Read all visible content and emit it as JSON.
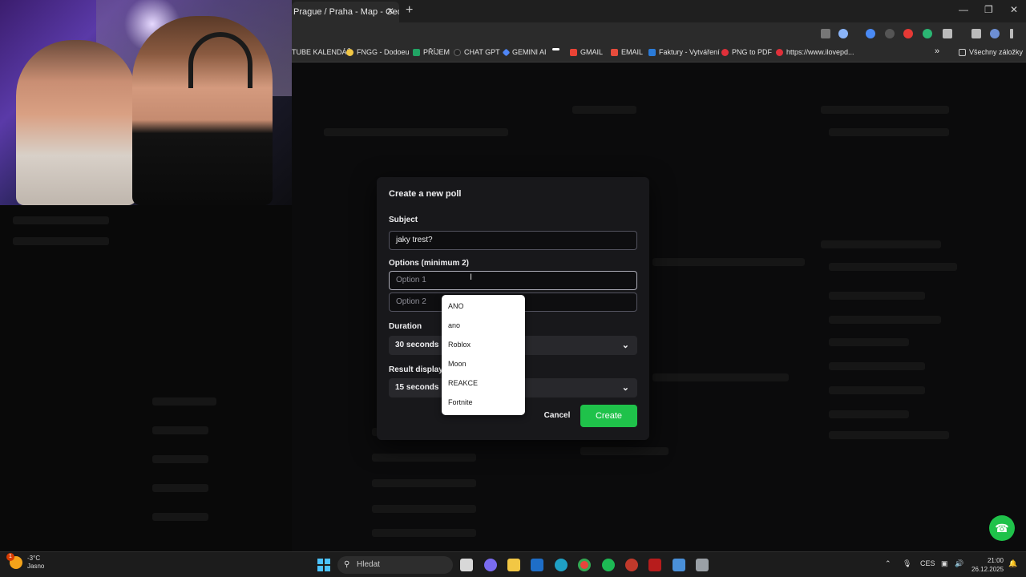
{
  "browser": {
    "tab_title": "Prague / Praha - Map - GeoGu",
    "tab_close": "✕",
    "new_tab": "+",
    "window_controls": [
      "—",
      "❐",
      "✕"
    ]
  },
  "bookmarks": [
    {
      "label": "TUBE KALENDÁŘ",
      "color": "#444444"
    },
    {
      "label": "FNGG - Dodoeu",
      "color": "#f2c744"
    },
    {
      "label": "PŘÍJEM",
      "color": "#21a464"
    },
    {
      "label": "CHAT GPT",
      "color": "#222222"
    },
    {
      "label": "GEMINI AI",
      "color": "#4f86f7"
    },
    {
      "label": "",
      "color": "#ffffff"
    },
    {
      "label": "GMAIL",
      "color": "#ea4335"
    },
    {
      "label": "EMAIL",
      "color": "#e74c3c"
    },
    {
      "label": "Faktury - Vytváření",
      "color": "#2b7bd8"
    },
    {
      "label": "PNG to PDF",
      "color": "#e0303a"
    },
    {
      "label": "https://www.ilovepd...",
      "color": "#e0303a"
    }
  ],
  "bookmarks_more": "»",
  "bookmarks_all": "Všechny záložky",
  "modal": {
    "title": "Create a new poll",
    "subject_label": "Subject",
    "subject_value": "jaky trest?",
    "options_label": "Options (minimum 2)",
    "option1_placeholder": "Option 1",
    "option2_placeholder": "Option 2",
    "duration_label": "Duration",
    "duration_value": "30 seconds",
    "result_label": "Result displayed",
    "result_value": "15 seconds",
    "cancel": "Cancel",
    "create": "Create"
  },
  "autocomplete": [
    "ANO",
    "ano",
    "Roblox",
    "Moon",
    "REAKCE",
    "Fortnite"
  ],
  "taskbar": {
    "weather_temp": "-3°C",
    "weather_desc": "Jasno",
    "weather_badge": "1",
    "search_placeholder": "Hledat",
    "lang": "CES",
    "time": "21:00",
    "date": "26.12.2025"
  },
  "colors": {
    "accent_green": "#1fc24a",
    "modal_bg": "#18181b",
    "windows_blue": "#4cc2ff"
  }
}
